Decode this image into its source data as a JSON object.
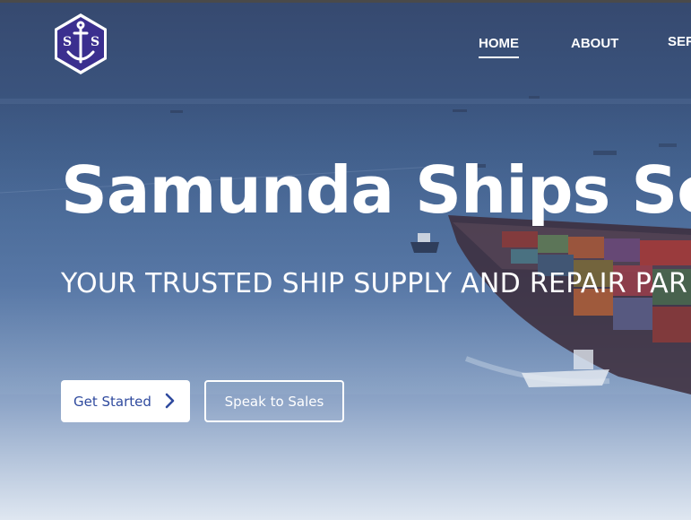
{
  "brand": {
    "logo_letters": "S S",
    "logo_icon": "anchor-icon"
  },
  "nav": {
    "items": [
      {
        "label": "HOME",
        "active": true
      },
      {
        "label": "ABOUT",
        "active": false
      },
      {
        "label": "SER",
        "active": false
      }
    ]
  },
  "hero": {
    "title": "Samunda Ships Ser",
    "subtitle": "YOUR TRUSTED SHIP SUPPLY AND REPAIR PAR",
    "primary_button": {
      "label": "Get Started",
      "icon": "chevron-right-icon"
    },
    "secondary_button": {
      "label": "Speak to Sales"
    }
  },
  "colors": {
    "overlay_top": "#36496f",
    "overlay_bottom": "#dfe7f1",
    "primary_button_text": "#2f4a9e",
    "logo_fill": "#3b2f8f"
  }
}
